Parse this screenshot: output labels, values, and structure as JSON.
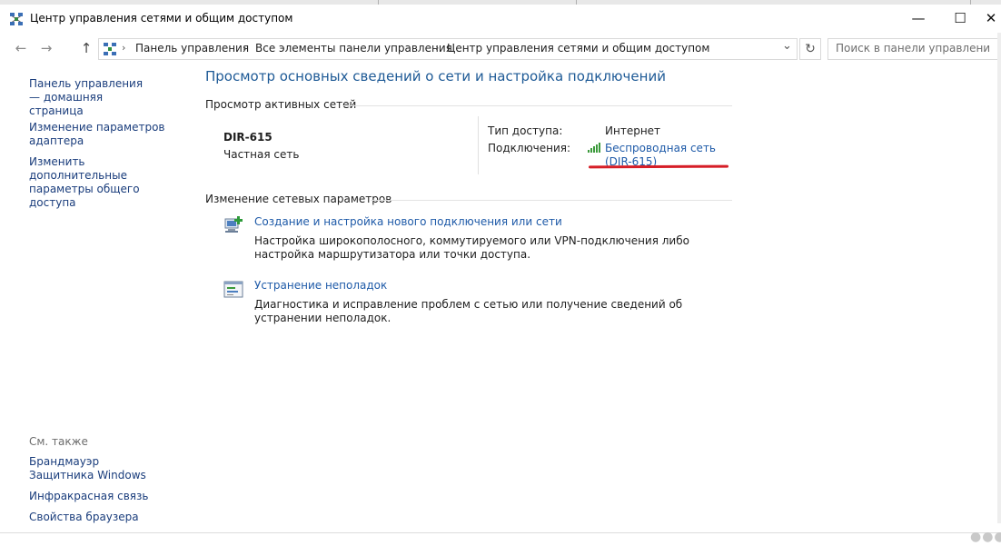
{
  "window": {
    "title": "Центр управления сетями и общим доступом",
    "minimize": "—",
    "maximize": "☐",
    "close": "✕"
  },
  "nav": {
    "back": "←",
    "forward": "→",
    "up": "↑",
    "dropdown": "⌄",
    "refresh": "↻"
  },
  "address": {
    "crumbs": [
      "Панель управления",
      "Все элементы панели управления",
      "Центр управления сетями и общим доступом"
    ],
    "sep": "›"
  },
  "search": {
    "placeholder": "Поиск в панели управления",
    "icon": "⌕"
  },
  "sidebar": {
    "items": [
      {
        "label": "Панель управления — домашняя страница"
      },
      {
        "label": "Изменение параметров адаптера"
      },
      {
        "label": "Изменить дополнительные параметры общего доступа"
      }
    ],
    "see_also_heading": "См. также",
    "see_also": [
      {
        "label": "Брандмауэр Защитника Windows"
      },
      {
        "label": "Инфракрасная связь"
      },
      {
        "label": "Свойства браузера"
      }
    ]
  },
  "main": {
    "title": "Просмотр основных сведений о сети и настройка подключений",
    "active_networks_heading": "Просмотр активных сетей",
    "network": {
      "name": "DIR-615",
      "type": "Частная сеть",
      "access_label": "Тип доступа:",
      "access_value": "Интернет",
      "connections_label": "Подключения:",
      "connection_line1": "Беспроводная сеть",
      "connection_line2": "(DIR-615)"
    },
    "change_heading": "Изменение сетевых параметров",
    "tasks": [
      {
        "title": "Создание и настройка нового подключения или сети",
        "desc": "Настройка широкополосного, коммутируемого или VPN-подключения либо настройка маршрутизатора или точки доступа."
      },
      {
        "title": "Устранение неполадок",
        "desc": "Диагностика и исправление проблем с сетью или получение сведений об устранении неполадок."
      }
    ]
  },
  "colors": {
    "link": "#1e5aa8",
    "heading": "#1e5a96",
    "annotation": "#d61e27"
  },
  "icons": [
    "network-center-icon",
    "wifi-signal-icon",
    "new-connection-icon",
    "troubleshoot-icon",
    "search-icon",
    "refresh-icon"
  ]
}
